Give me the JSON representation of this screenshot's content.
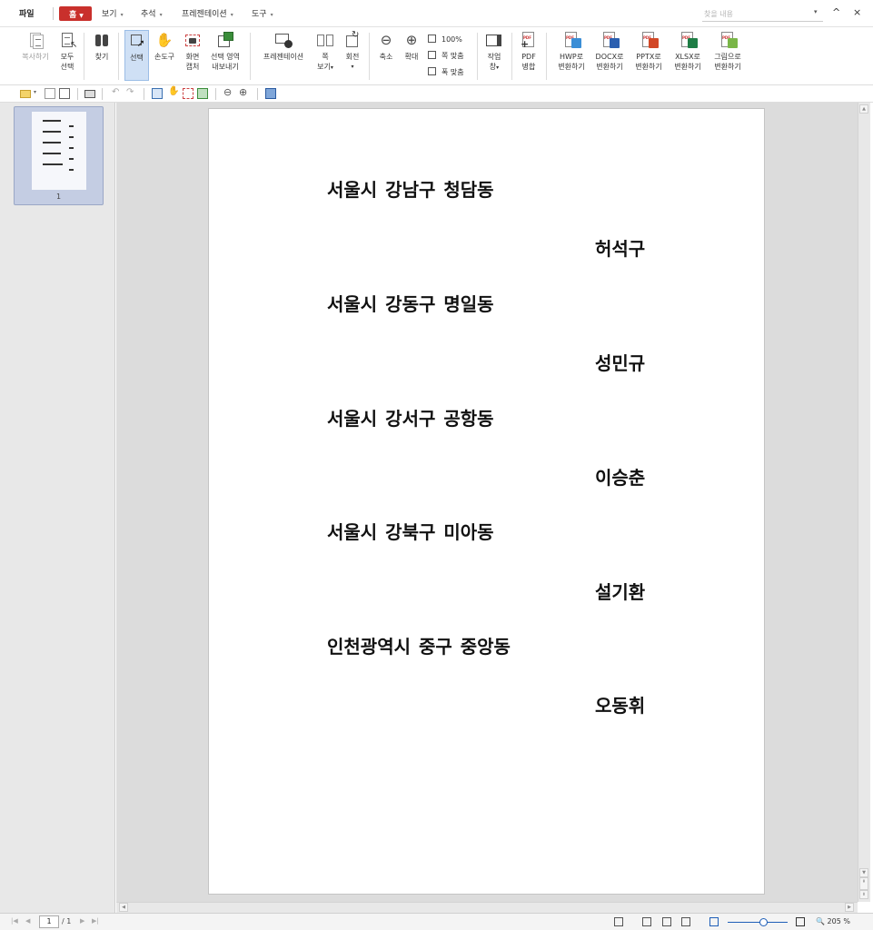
{
  "menu": {
    "file": "파일",
    "home": "홈",
    "view": "보기",
    "annotate": "추석",
    "presentation": "프레젠테이션",
    "tools": "도구",
    "search_placeholder": "찾을 내용"
  },
  "ribbon": {
    "copy": "복사하기",
    "select_all_1": "모두",
    "select_all_2": "선택",
    "find": "찾기",
    "select": "선택",
    "hand": "손도구",
    "capture_1": "화면",
    "capture_2": "캡처",
    "export_area_1": "선택 영역",
    "export_area_2": "내보내기",
    "presentation": "프레젠테이션",
    "page_view_1": "쪽",
    "page_view_2": "보기",
    "rotate": "회전",
    "zoom_out": "축소",
    "zoom_in": "확대",
    "zoom_100": "100%",
    "fit_page": "쪽 맞춤",
    "fit_width": "폭 맞춤",
    "work_pane_1": "작업",
    "work_pane_2": "창",
    "pdf_merge_1": "PDF",
    "pdf_merge_2": "병합",
    "to_hwp_1": "HWP로",
    "to_docx_1": "DOCX로",
    "to_pptx_1": "PPTX로",
    "to_xlsx_1": "XLSX로",
    "to_image_1": "그림으로",
    "convert": "변환하기"
  },
  "thumbnail": {
    "page_number": "1"
  },
  "document": {
    "lines": [
      "서울시 강남구 청담동",
      "허석구",
      "서울시 강동구 명일동",
      "성민규",
      "서울시 강서구 공항동",
      "이승춘",
      "서울시 강북구 미아동",
      "설기환",
      "인천광역시 중구 중앙동",
      "오동휘"
    ]
  },
  "status": {
    "current_page": "1",
    "total_pages": "/ 1",
    "zoom": "205 %"
  },
  "colors": {
    "accent": "#c9302c",
    "selection": "#cfe0f5",
    "zoom": "#1f5fb8"
  }
}
